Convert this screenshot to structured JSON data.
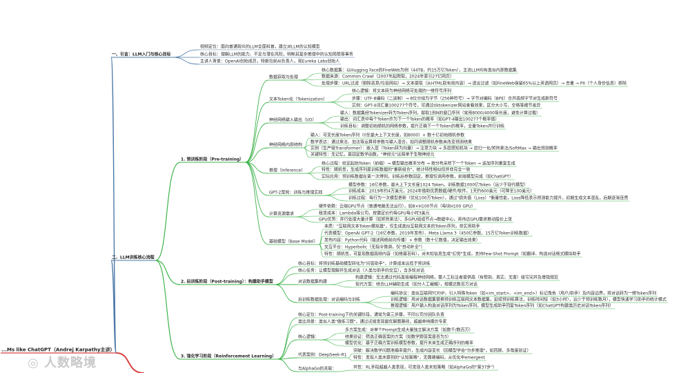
{
  "root": {
    "label": "...Ms like ChatGPT（Andrej Karpathy主讲）"
  },
  "watermark": "◎ 人数略境",
  "colors": {
    "root_edge": "#d94040",
    "intro_branch": "#4a78a6",
    "pretrain_branch": "#3cb34a",
    "post_branch": "#3cb34a",
    "rl_branch": "#3cb34a",
    "main_branch": "#4a78a6"
  },
  "intro": {
    "title": "一、引言：LLM入门与核心目标",
    "items": [
      "视频定位：面向普通观众的LLM全面科普，建立对LLM的认知模型",
      "核心目标：理解LLM的能力、不足与潜在风险，明晰其复杂推理中的认知局限等事务",
      "主讲人背景：OpenAI创始成员，特斯拉前AI负责人，现Eureka Labs创始人"
    ]
  },
  "main": {
    "title": "二、LLM训练核心流程",
    "pretrain": {
      "title": "1. 预训练阶段（Pre-training）",
      "data": {
        "title": "数据获取与处理",
        "items": [
          "核心数据集：以Hugging Face的FineWeb为例（44TB，约15万亿Token），主流LLM均有类似内部数据集",
          "数据来源：Common Crawl（2007年起爬取，2024年索引27亿网页）",
          "处理步骤：URL过滤（剔除恶意/垃圾网站）→ 文本提取（从HTML取有效内容）→ 语言过滤（如FineWeb保留65%以上英语网页）→ 去重 → PII（个人身份信息）移除"
        ]
      },
      "token": {
        "title": "文本Token化（Tokenization）",
        "items": [
          "核心逻辑：将文本转为神经网络可处理的一维符号序列",
          "步骤：UTF-8编码（二进制）→ 8位分组为字节（256种符号）→ 字节对编码（BPE）合并高频字节对生成新符号",
          "实例：GPT-4词汇量100277个符号，可通过tiktokenizer网站查看效果，区分大小写、空格等细节差异"
        ]
      },
      "io": {
        "title": "神经网络输入输出（I/O）",
        "items": [
          "输入：数据集经Tokenizer转为Token序列，提取1到N的窗口序列（常用8000/4000等长度，避免计算过载）",
          "输出：词汇表中每个Token作为下一个Token的概率（如GPT-4输出100277个概率值）",
          "训练目标：调整初始随机的网络参数，提升正确下一个Token的概率，全量Token并行训练"
        ]
      },
      "internal": {
        "title": "神经网络内部结构",
        "items": [
          "输入：可变长度Token序列（0至最大上下文长度，如8000）+ 数十亿初始随机参数",
          "数学表达：通过乘法、加法等运算将参数与输入混合，如同调整随机参数来改变预测结果",
          "实例（生产级Transformer）：嵌入层（Token转为向量）→ 注意力块 → 多层感知机块 → 层归一化/矩阵乘法/SoftMax → 输出预测概率",
          "关键特性：无记忆，是固定数学函数，\"神经元\"远简单于生物神经元"
        ]
      },
      "inference": {
        "title": "推理（Inference）",
        "items": [
          "核心过程：给定起始Token（前缀）→ 模型输出概率分布 → 按分布采样下一个Token → 追加序列重复生成",
          "特性：随机性，生成序列是训练数据的\"重新组合\"，统计特性相似但并非完全一致",
          "实际应用：预训练数据在第一次得到，训练后参数固定，推理仅调用参数，前端模型完成（如ChatGPT）"
        ]
      },
      "gpt2": {
        "title": "GPT-2案例：训练与推理实践",
        "items": [
          "模型参数：16亿参数，最大上下文长度1024 Token，训练数据1000亿Token（远少于现代模型）",
          "训练成本：2019年约4万美元，2024年借助优质数据/硬件/软件，1天约600美元（可降至100美元）",
          "训练过程：每行为一次模型更新（优化100万Token），通过\"损失值（Loss）\"衡量性能，Loss降低表示预测能力提升，初期生成文本混乱，后期逐渐连贯"
        ]
      },
      "compute": {
        "title": "计算资源需求",
        "items": [
          "硬件依赖：云端GPU节点（普通电脑无法运行），如8×H100节点（每块H100 GPU）",
          "租赁成本：Lambda等公司，按需定价约每GPU每小时3美元",
          "GPU优势：并行处理大量计算（如矩阵乘法），多GPU组成节点→数据中心，英伟达GPU需求推动股价上涨"
        ]
      },
      "base": {
        "title": "基础模型（Base Model）",
        "items": [
          "本质：\"互联网文本Token模拟器\"，仅生成类似互联网文本的Token序列，非实用助手",
          "代表模型：OpenAI GPT-2（16亿参数，2019年发布）、Meta Llama 3（450亿参数，15万亿Token训练数据）",
          "发布内容：Python代码（描述网络前向传播）+ 参数（数十亿数值，决定输出效果）",
          "交互平台：Hyperbolic（无指令微调，仅\"自动补全\"）",
          "特性：随机性，可复现数据高频内容（如维基百科），对未知信息生成\"幻觉\"生成，支持Few-Shot Prompt（如翻译、构造对话格式模拟助手"
        ]
      }
    },
    "post": {
      "title": "2. 后训练阶段（Post-training）：构建助手模型",
      "goals": [
        "核心目标：将预训练基础模型转化为\"问答助手\"，计算成本远低于预训练",
        "核心任务：让模型理解并生成对话（人类与助手的交互），含多轮对话"
      ],
      "dataset": {
        "title": "对话数据集构建",
        "items": [
          "构建逻辑：无法通过代码直接编程神经网络，需人工标注者提供高（有帮助、真实、无害）级写完并及增强规范",
          "现代方案：结合LLM辅助生成（如分人工编辑），规模达数百万对话"
        ]
      },
      "token": {
        "title": "后训练数据处理：对话编码与训练",
        "items": [
          "编码协议：类似互联网TCP/IP，引入特殊Token（如<im_start>、<im_end>）标记角色（用户/助手）及内容边界，将对话转为一维Token序列",
          "训练逻辑：用对话数据集替换预训练互联网文本数据集，延续预训练算法，训练时间短（如3小时），远少于预训练数月），模型快速学习助手的统计模式",
          "推理逻辑：用户输入构造对话序列为Token序列，模型生成助手回复Token序列（如ChatGPT构建类历史对话Token序列）"
        ]
      }
    },
    "rl": {
      "title": "3. 强化学习阶段（Reinforcement Learning）",
      "items": [
        "核心定位：Post-training下的关键阶段，通常为第三步骤，不同公司分团队负责",
        "类比场景：类似人类\"做练习题\"，通过试错发现最优解题路径，超越单纯模仿专家"
      ],
      "logic": {
        "title": "核心逻辑：",
        "items": [
          "多方案生成：对单个Prompt生成大量独立解决方案（如数千/数百万）",
          "结果验证：筛选正确答案的方案（如数学题答案是否为3）",
          "模型优化：基于正确方案训练模型参数，提升未来生成正确序列的概率"
        ]
      },
      "deepseek": {
        "title": "代表案例：DeepSeek-R1",
        "items": [
          "突破：解决数学问题准确率提升，生成内容变长（因模型学会\"分步推理\"，如回顾、多角度验证）",
          "特性：发现人类未察到的\"认知策略\"，无需硬编码，从优化中emergent"
        ]
      },
      "alphago": {
        "title": "与AlphaGo的关联：",
        "items": [
          "共性：RL手段超越人类表现，可发现人类未知策略（如AlphaGo的\"第37步\"）"
        ]
      }
    }
  }
}
